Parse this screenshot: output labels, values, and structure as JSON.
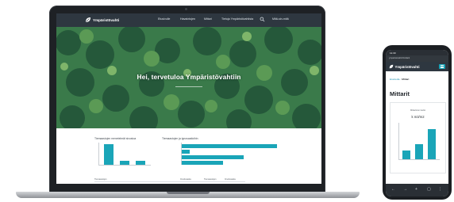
{
  "laptop": {
    "brand": "Ympäristövahti",
    "nav": [
      "Etusivulle",
      "Havaintojen",
      "Mittari",
      "Tietoja Ympäristövahtista",
      "Mitä-sin-mitä"
    ],
    "hero_title": "Hei, tervetuloa Ympäristövahtiin",
    "chart_data": [
      {
        "type": "bar",
        "title": "Tiemaastojen menetelmät sivustoa",
        "categories": [
          "",
          "",
          ""
        ],
        "values": [
          10,
          2,
          2
        ]
      },
      {
        "type": "bar",
        "title": "Tiemaastojen ja ignosaatioihin",
        "categories": [
          "",
          "",
          "",
          ""
        ],
        "values": [
          46,
          4,
          30,
          20
        ]
      }
    ],
    "table": {
      "headers": [
        "Tiemaastojen",
        "Ilmoitusaika",
        "Tiemaastojen",
        "Ilmoitusaika"
      ]
    }
  },
  "phone": {
    "time": "12.30",
    "url": "ymparistovahti.fi/mittarit",
    "brand": "Ympäristövahti",
    "breadcrumb": [
      "Etusivulle",
      "/",
      "Mittari"
    ],
    "title": "Mittarit",
    "chart_data": {
      "type": "bar",
      "title": "Mittariston tiedot",
      "unit": "k m3/m2",
      "categories": [
        "",
        "",
        ""
      ],
      "values": [
        1.0,
        1.7,
        3.5
      ],
      "ylim": [
        0,
        4
      ]
    }
  },
  "colors": {
    "accent": "#1aa5b8",
    "nav": "#2e3740",
    "forest": "#2e6a40"
  }
}
